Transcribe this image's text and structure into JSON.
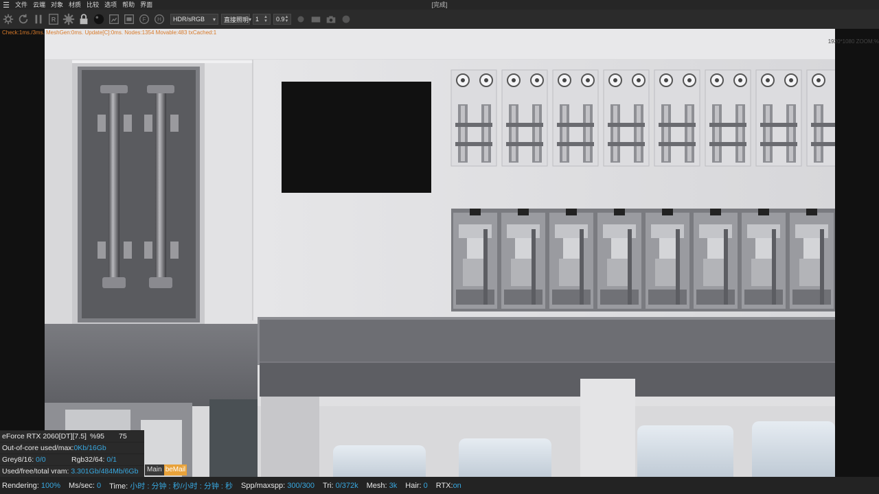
{
  "menu": {
    "items": [
      "文件",
      "云端",
      "对象",
      "材质",
      "比较",
      "选项",
      "帮助",
      "界面"
    ],
    "window_title": "[完成]"
  },
  "toolbar": {
    "icons": [
      "settings-cog-icon",
      "refresh-icon",
      "pause-icon",
      "r-box-icon",
      "gear-icon",
      "lock-icon",
      "sphere-icon",
      "render-region-icon",
      "film-icon",
      "focus-icon",
      "picker-icon"
    ],
    "display_mode": "HDR/sRGB",
    "kernel": "直接照明",
    "spin1": "1",
    "spin2": "0.9"
  },
  "info": {
    "line": "Check:1ms./3ms. MeshGen:0ms. Update[C]:0ms. Nodes:1354 Movable:483 txCached:1",
    "zoom": "1920*1080 ZOOM:%"
  },
  "stats": {
    "gpu": "eForce RTX 2060[DT][7.5]",
    "gpu_pct": "%95",
    "gpu_temp": "75",
    "ooc_label": "Out-of-core used/max:",
    "ooc_value": "0Kb/16Gb",
    "grey_label": "Grey8/16:",
    "grey_value": "0/0",
    "rgb_label": "Rgb32/64:",
    "rgb_value": "0/1",
    "vram_label": "Used/free/total vram:",
    "vram_value": "3.301Gb/484Mb/6Gb",
    "tag_main": "Main",
    "tag_mail": "beMail"
  },
  "status": {
    "rendering_label": "Rendering:",
    "rendering_value": "100%",
    "ms_label": "Ms/sec:",
    "ms_value": "0",
    "time_label": "Time:",
    "time_value": "小时 : 分钟 : 秒/小时 : 分钟 : 秒",
    "spp_label": "Spp/maxspp:",
    "spp_value": "300/300",
    "tri_label": "Tri:",
    "tri_value": "0/372k",
    "mesh_label": "Mesh:",
    "mesh_value": "3k",
    "hair_label": "Hair:",
    "hair_value": "0",
    "rtx_label": "RTX:",
    "rtx_value": "on"
  },
  "colors": {
    "accent_blue": "#38a8e0",
    "info_orange": "#d87a2a",
    "tag_orange": "#e8a23a"
  }
}
